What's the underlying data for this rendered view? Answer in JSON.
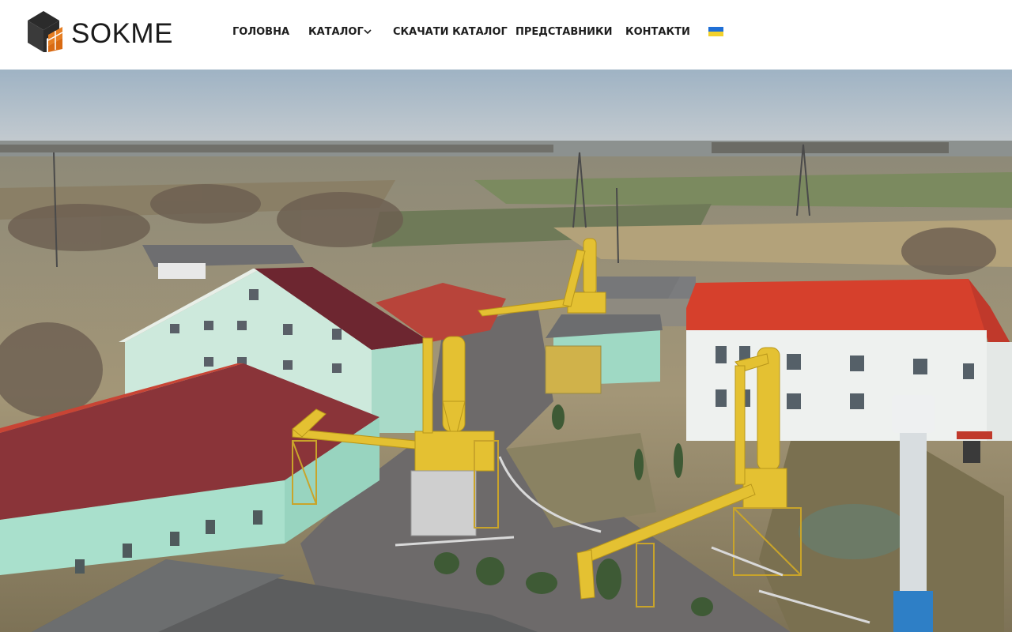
{
  "brand": {
    "name": "SOKME",
    "logo_colors": {
      "dark": "#2b2b2b",
      "accent": "#e67e22"
    }
  },
  "nav": {
    "items": [
      {
        "label": "ГОЛОВНА"
      },
      {
        "label": "КАТАЛОГ",
        "has_dropdown": true
      },
      {
        "label": "СКАЧАТИ КАТАЛОГ"
      },
      {
        "label": "ПРЕДСТАВНИКИ"
      },
      {
        "label": "КОНТАКТИ"
      }
    ],
    "language_flag": {
      "icon": "ukraine-flag-icon",
      "colors": [
        "#1f6fd6",
        "#f2d12c"
      ]
    }
  },
  "hero": {
    "image": "aerial-factory-photo",
    "colors": {
      "sky": "#aab9c6",
      "field": "#a89a78",
      "roof_red": "#c83a2a",
      "roof_maroon": "#7a2a30",
      "wall_mint": "#a8dcc6",
      "pipes_yellow": "#e6c22a"
    }
  }
}
